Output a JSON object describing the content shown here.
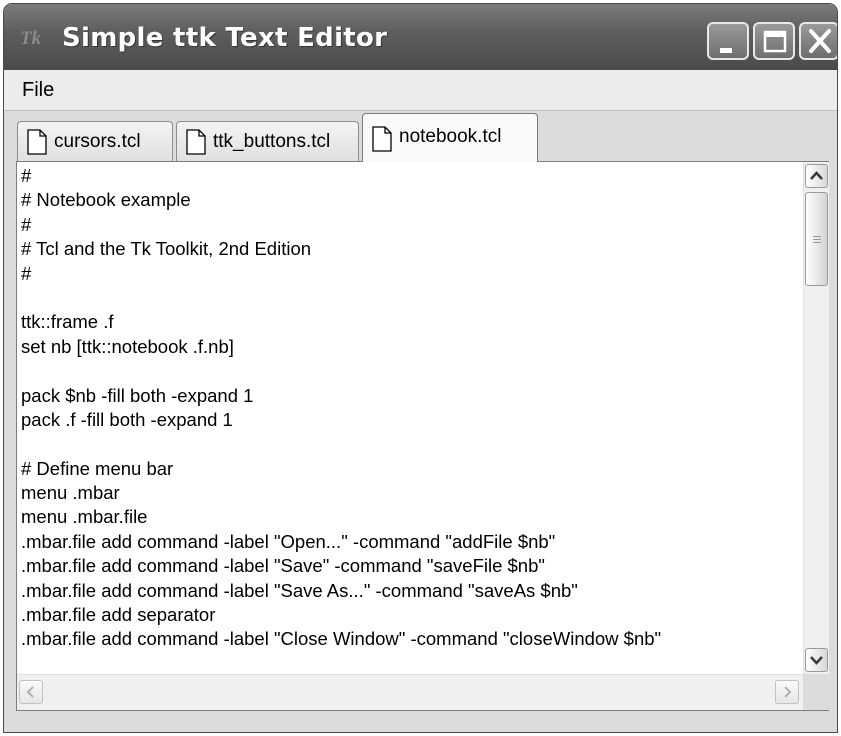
{
  "window": {
    "title": "Simple ttk Text Editor",
    "app_icon_text": "Tk"
  },
  "menubar": {
    "items": [
      {
        "label": "File"
      }
    ]
  },
  "tabs": [
    {
      "label": "cursors.tcl",
      "active": false
    },
    {
      "label": "ttk_buttons.tcl",
      "active": false
    },
    {
      "label": "notebook.tcl",
      "active": true
    }
  ],
  "editor": {
    "lines": [
      "#",
      "# Notebook example",
      "#",
      "# Tcl and the Tk Toolkit, 2nd Edition",
      "#",
      "",
      "ttk::frame .f",
      "set nb [ttk::notebook .f.nb]",
      "",
      "pack $nb -fill both -expand 1",
      "pack .f -fill both -expand 1",
      "",
      "# Define menu bar",
      "menu .mbar",
      "menu .mbar.file",
      ".mbar.file add command -label \"Open...\" -command \"addFile $nb\"",
      ".mbar.file add command -label \"Save\" -command \"saveFile $nb\"",
      ".mbar.file add command -label \"Save As...\" -command \"saveAs $nb\"",
      ".mbar.file add separator",
      ".mbar.file add command -label \"Close Window\" -command \"closeWindow $nb\""
    ]
  },
  "colors": {
    "titlebar": "#5f5f5f",
    "window_bg": "#dcdcdc",
    "editor_bg": "#ffffff"
  },
  "icons": {
    "minimize": "minimize-icon",
    "maximize": "maximize-icon",
    "close": "close-icon",
    "tab": "document-icon"
  }
}
